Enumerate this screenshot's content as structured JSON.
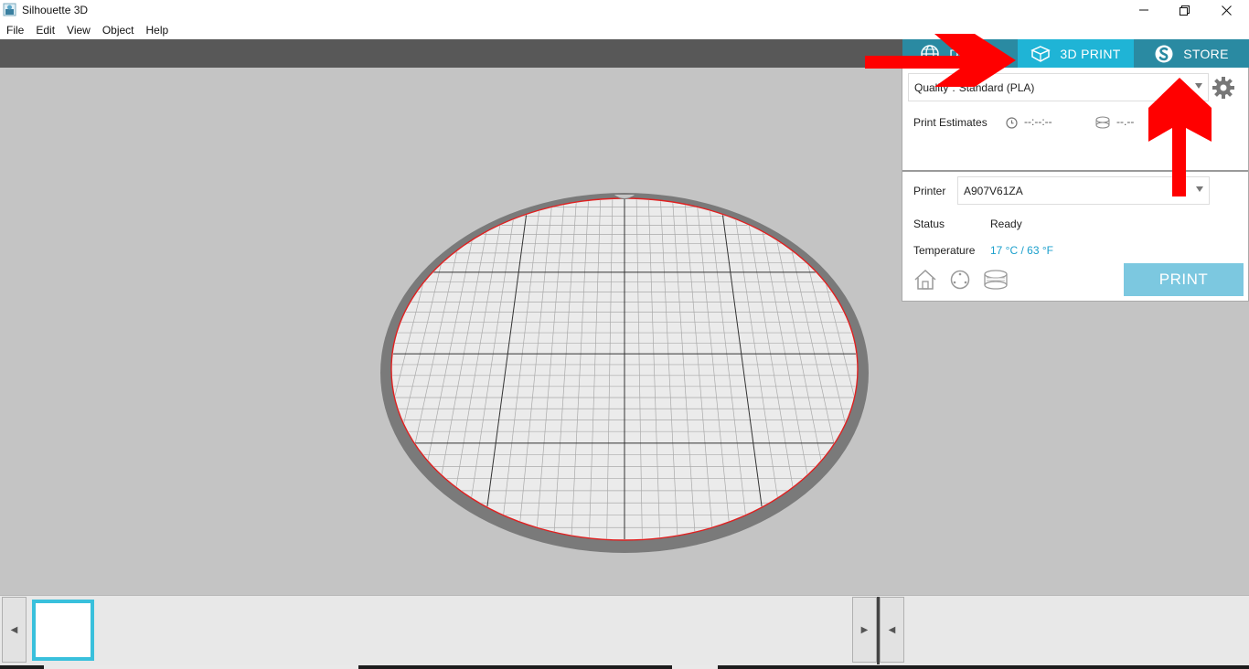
{
  "window": {
    "title": "Silhouette 3D",
    "controls": [
      "minimize-icon",
      "restore-icon",
      "close-icon"
    ]
  },
  "menu": [
    "File",
    "Edit",
    "View",
    "Object",
    "Help"
  ],
  "tabs": [
    {
      "label": "DESIGN",
      "icon": "globe-icon"
    },
    {
      "label": "3D PRINT",
      "icon": "cube-icon",
      "active": true
    },
    {
      "label": "STORE",
      "icon": "silhouette-s-icon"
    }
  ],
  "print_panel": {
    "quality_label": "Quality",
    "quality_value": "Standard (PLA)",
    "estimates_label": "Print Estimates",
    "time_estimate": "--:--:--",
    "material_estimate": "--.--",
    "printer_label": "Printer",
    "printer_value": "A907V61ZA",
    "status_label": "Status",
    "status_value": "Ready",
    "temperature_label": "Temperature",
    "temperature_value": "17 °C / 63 °F",
    "print_button": "PRINT"
  },
  "colors": {
    "tab_active": "#1fb4d6",
    "tab_inactive": "#2a8aa2",
    "temperature_text": "#1a9fcc",
    "print_button": "#7cc8e0",
    "annotation_arrow": "#ff0000",
    "build_plate_edge": "#e02020"
  },
  "icons": {
    "home": "home-icon",
    "nozzle": "nozzle-icon",
    "filament": "filament-spool-icon",
    "settings": "gear-icon",
    "clock": "clock-icon"
  },
  "bottom_bar": {
    "left_nav": "◀",
    "right_nav": "▶",
    "collapse_nav": "◀"
  }
}
